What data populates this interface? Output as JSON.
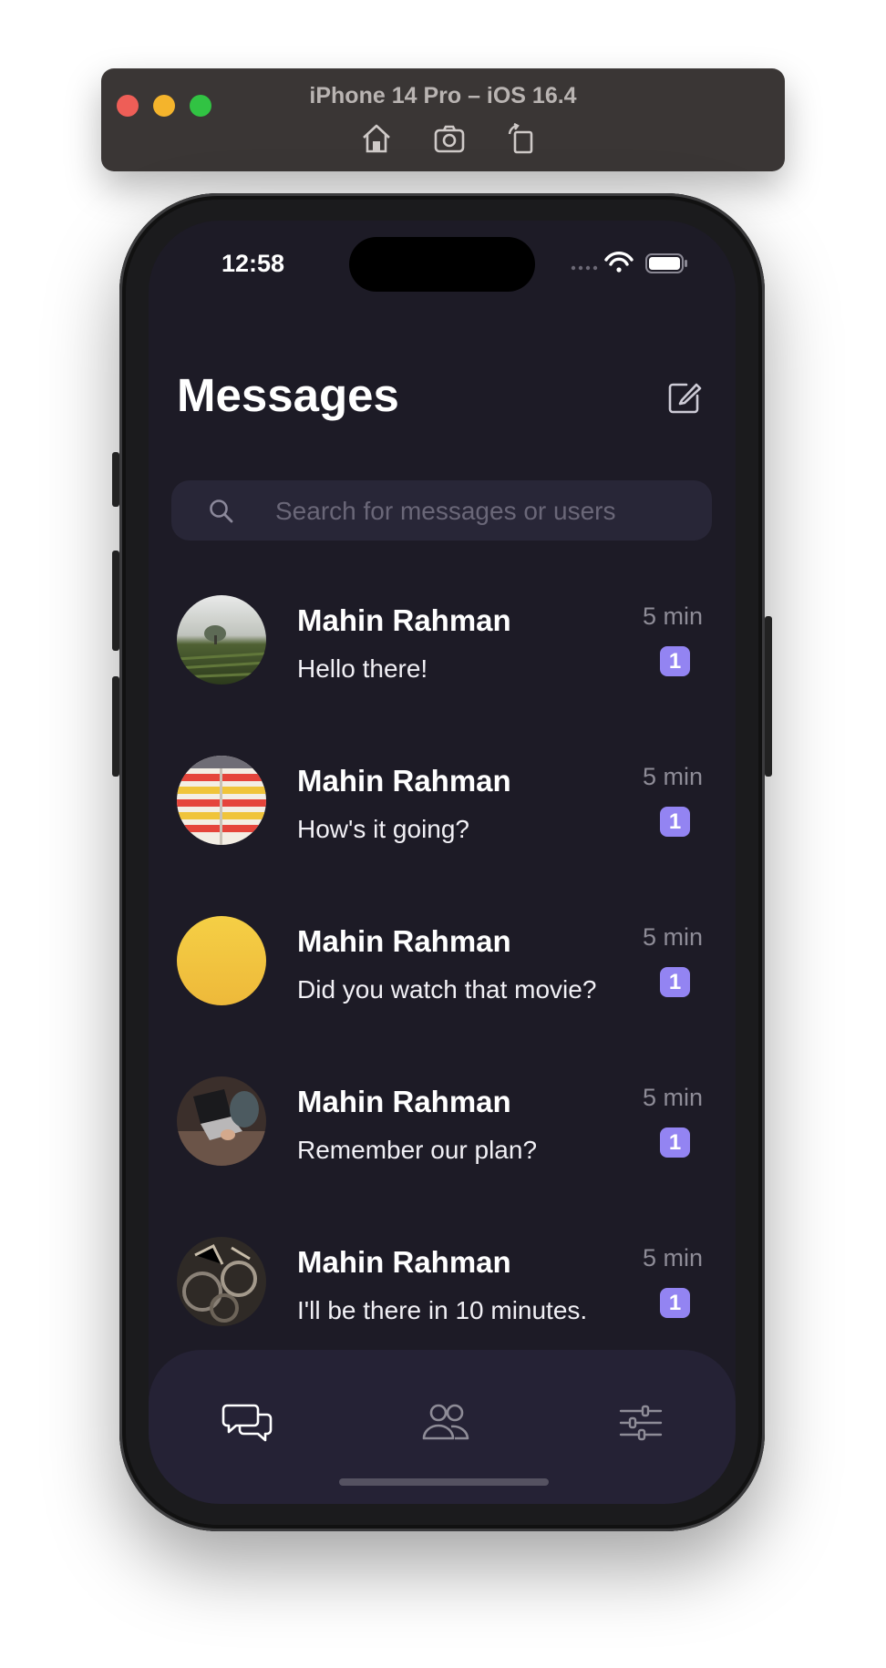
{
  "simulator": {
    "title": "iPhone 14 Pro – iOS 16.4",
    "tools": [
      "home-icon",
      "screenshot-icon",
      "rotate-icon"
    ]
  },
  "status_bar": {
    "time": "12:58",
    "icons": [
      "cellular-icon",
      "wifi-icon",
      "battery-icon"
    ]
  },
  "header": {
    "title": "Messages",
    "compose_icon": "compose-icon"
  },
  "search": {
    "placeholder": "Search for messages or users",
    "value": ""
  },
  "conversations": [
    {
      "name": "Mahin Rahman",
      "message": "Hello there!",
      "time": "5 min",
      "unread": "1",
      "avatar": "field-photo"
    },
    {
      "name": "Mahin Rahman",
      "message": "How's it going?",
      "time": "5 min",
      "unread": "1",
      "avatar": "striped-photo"
    },
    {
      "name": "Mahin Rahman",
      "message": "Did you watch that movie?",
      "time": "5 min",
      "unread": "1",
      "avatar": "yellow-photo"
    },
    {
      "name": "Mahin Rahman",
      "message": "Remember our plan?",
      "time": "5 min",
      "unread": "1",
      "avatar": "laptop-photo"
    },
    {
      "name": "Mahin Rahman",
      "message": "I'll be there in 10 minutes.",
      "time": "5 min",
      "unread": "1",
      "avatar": "bikes-photo"
    }
  ],
  "tab_bar": {
    "tabs": [
      {
        "icon": "chat-icon",
        "active": true
      },
      {
        "icon": "people-icon",
        "active": false
      },
      {
        "icon": "settings-sliders-icon",
        "active": false
      }
    ]
  },
  "colors": {
    "background": "#1d1b26",
    "search_bg": "#282637",
    "tab_bar_bg": "#252235",
    "badge": "#9384f2",
    "muted_text": "#8e8c97"
  }
}
